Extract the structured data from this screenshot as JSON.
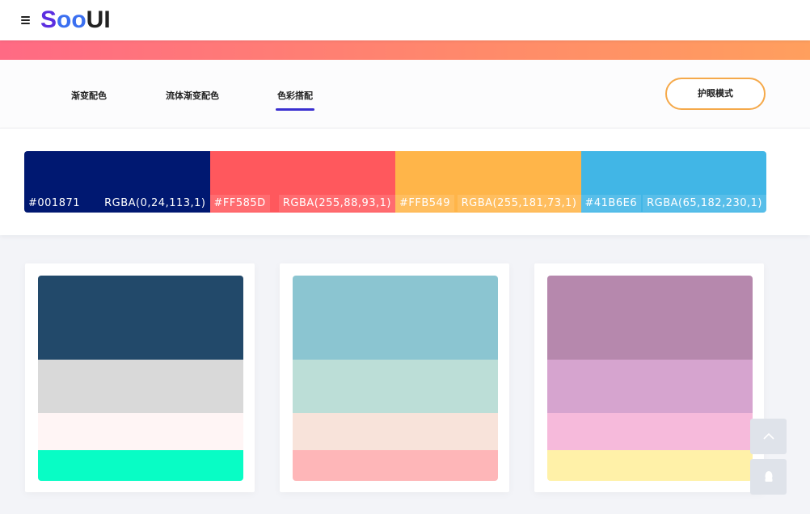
{
  "header": {
    "logo": {
      "s": "S",
      "o1": "o",
      "o2": "o",
      "ui": "UI"
    }
  },
  "tabs": [
    {
      "label": "渐变配色",
      "active": false
    },
    {
      "label": "流体渐变配色",
      "active": false
    },
    {
      "label": "色彩搭配",
      "active": true
    }
  ],
  "eye_mode_label": "护眼模式",
  "palette": [
    {
      "hex": "#001871",
      "rgba": "RGBA(0,24,113,1)",
      "color": "#001871"
    },
    {
      "hex": "#FF585D",
      "rgba": "RGBA(255,88,93,1)",
      "color": "#FF585D"
    },
    {
      "hex": "#FFB549",
      "rgba": "RGBA(255,181,73,1)",
      "color": "#FFB549"
    },
    {
      "hex": "#41B6E6",
      "rgba": "RGBA(65,182,230,1)",
      "color": "#41B6E6"
    }
  ],
  "cards": [
    {
      "colors": [
        "#22496a",
        "#d9d9d9",
        "#fff5f5",
        "#08fdc5"
      ]
    },
    {
      "colors": [
        "#8bc5d1",
        "#bcded7",
        "#f8e3da",
        "#feb6b8"
      ]
    },
    {
      "colors": [
        "#b688ad",
        "#d6a4cf",
        "#f6badb",
        "#fff1a8"
      ]
    }
  ],
  "icons": {
    "menu": "hamburger-menu-icon",
    "back_to_top": "chevron-up-icon",
    "qq": "qq-penguin-icon"
  }
}
